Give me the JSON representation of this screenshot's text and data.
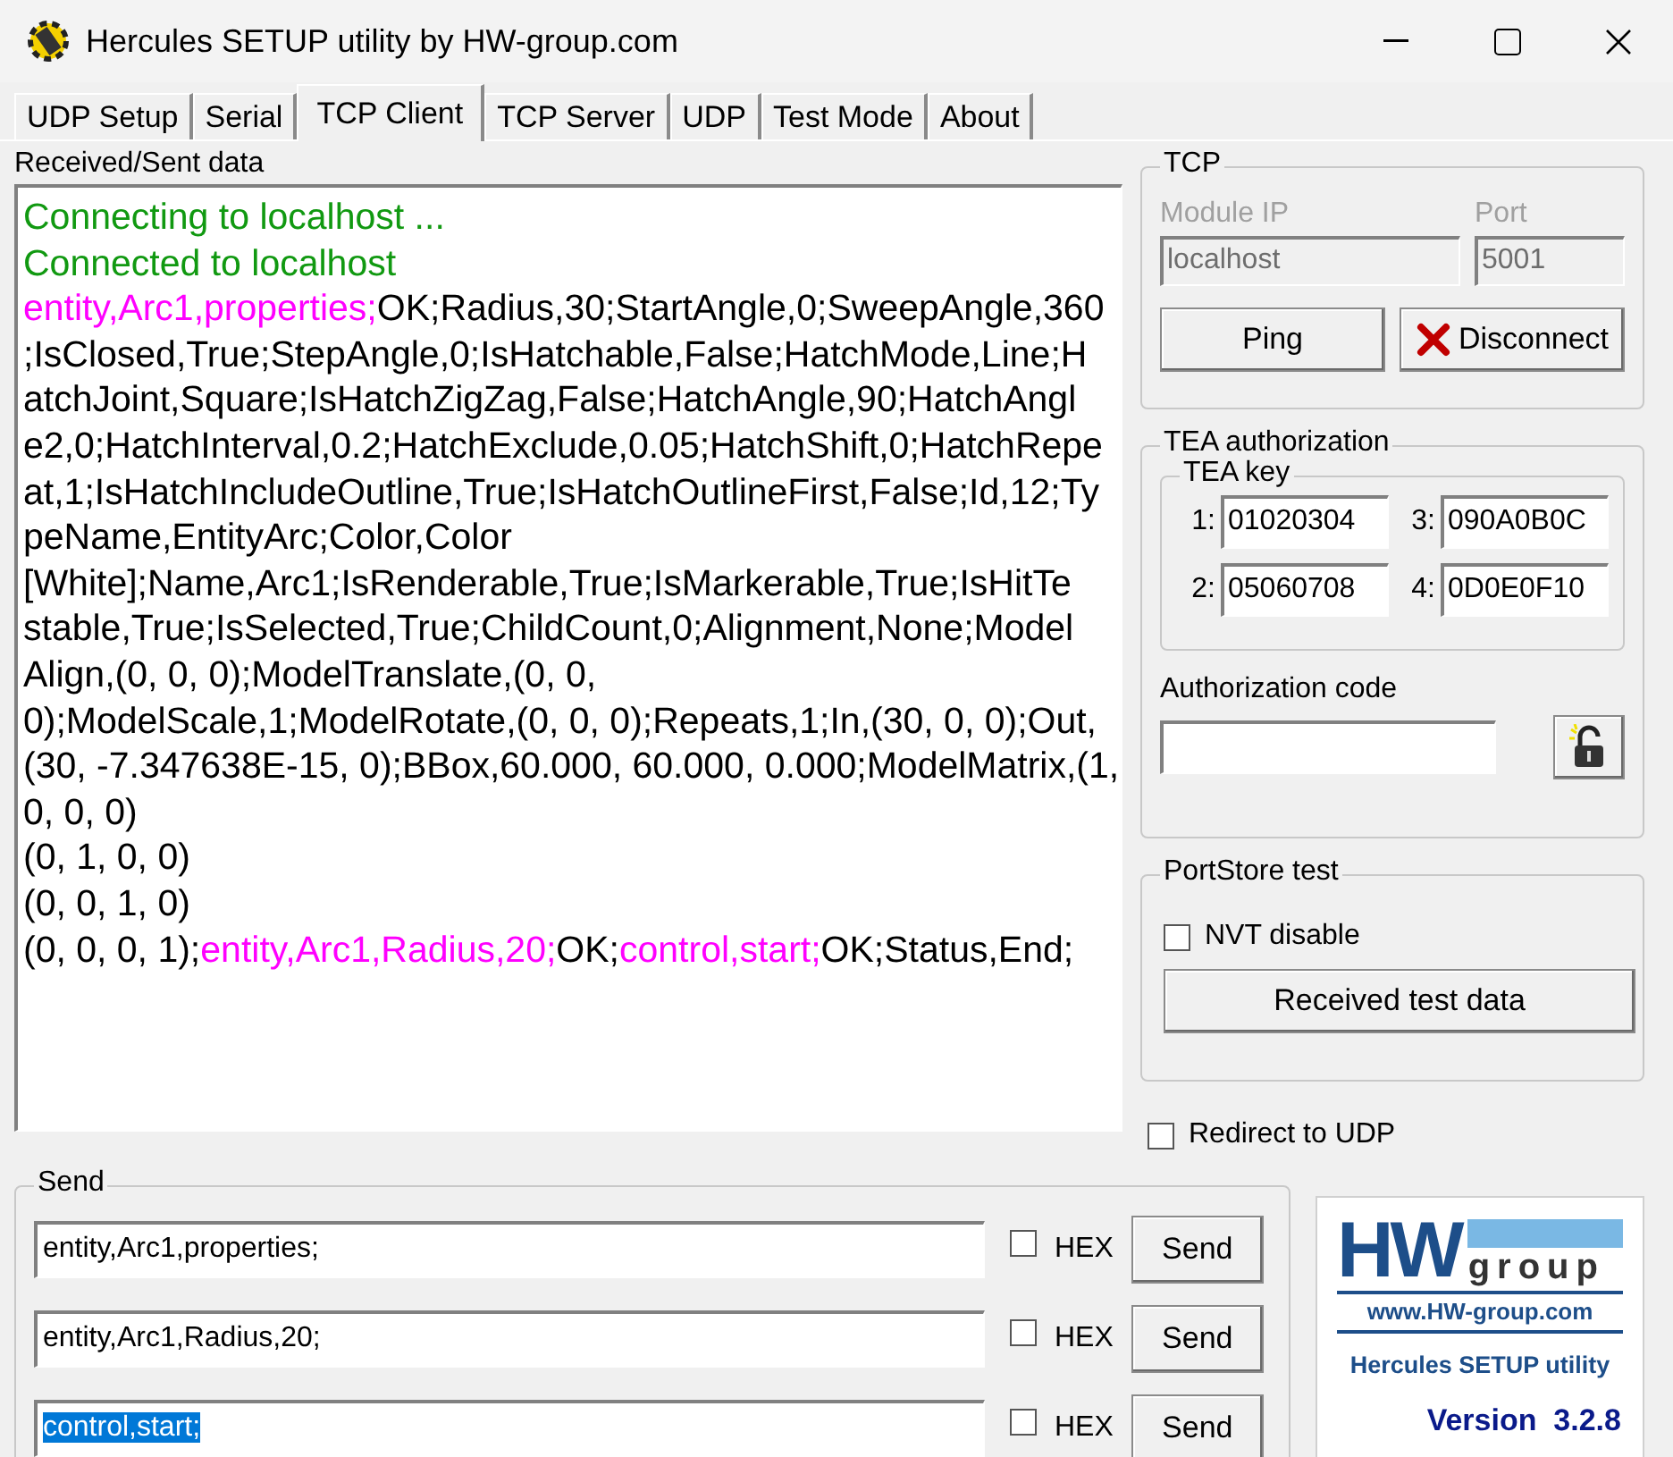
{
  "window": {
    "title": "Hercules SETUP utility by HW-group.com"
  },
  "tabs": [
    {
      "label": "UDP Setup",
      "selected": false
    },
    {
      "label": "Serial",
      "selected": false
    },
    {
      "label": "TCP Client",
      "selected": true
    },
    {
      "label": "TCP Server",
      "selected": false
    },
    {
      "label": "UDP",
      "selected": false
    },
    {
      "label": "Test Mode",
      "selected": false
    },
    {
      "label": "About",
      "selected": false
    }
  ],
  "log": {
    "title": "Received/Sent data",
    "lines": [
      [
        {
          "kind": "status",
          "text": "Connecting to localhost ..."
        }
      ],
      [
        {
          "kind": "status",
          "text": "Connected to localhost"
        }
      ],
      [
        {
          "kind": "sent",
          "text": "entity,Arc1,properties;"
        },
        {
          "kind": "received",
          "text": "OK;Radius,30;StartAngle,0;SweepAngle,360"
        }
      ],
      [
        {
          "kind": "received",
          "text": ";IsClosed,True;StepAngle,0;IsHatchable,False;HatchMode,Line;H"
        }
      ],
      [
        {
          "kind": "received",
          "text": "atchJoint,Square;IsHatchZigZag,False;HatchAngle,90;HatchAngl"
        }
      ],
      [
        {
          "kind": "received",
          "text": "e2,0;HatchInterval,0.2;HatchExclude,0.05;HatchShift,0;HatchRepe"
        }
      ],
      [
        {
          "kind": "received",
          "text": "at,1;IsHatchIncludeOutline,True;IsHatchOutlineFirst,False;Id,12;Ty"
        }
      ],
      [
        {
          "kind": "received",
          "text": "peName,EntityArc;Color,Color"
        }
      ],
      [
        {
          "kind": "received",
          "text": "[White];Name,Arc1;IsRenderable,True;IsMarkerable,True;IsHitTe"
        }
      ],
      [
        {
          "kind": "received",
          "text": "stable,True;IsSelected,True;ChildCount,0;Alignment,None;Model"
        }
      ],
      [
        {
          "kind": "received",
          "text": "Align,(0, 0, 0);ModelTranslate,(0, 0,"
        }
      ],
      [
        {
          "kind": "received",
          "text": "0);ModelScale,1;ModelRotate,(0, 0, 0);Repeats,1;In,(30, 0, 0);Out,"
        }
      ],
      [
        {
          "kind": "received",
          "text": "(30, -7.347638E-15, 0);BBox,60.000, 60.000, 0.000;ModelMatrix,(1,"
        }
      ],
      [
        {
          "kind": "received",
          "text": "0, 0, 0)"
        }
      ],
      [
        {
          "kind": "received",
          "text": "(0, 1, 0, 0)"
        }
      ],
      [
        {
          "kind": "received",
          "text": "(0, 0, 1, 0)"
        }
      ],
      [
        {
          "kind": "received",
          "text": "(0, 0, 0, 1);"
        },
        {
          "kind": "sent",
          "text": "entity,Arc1,Radius,20;"
        },
        {
          "kind": "received",
          "text": "OK;"
        },
        {
          "kind": "sent",
          "text": "control,start;"
        },
        {
          "kind": "received",
          "text": "OK;Status,End;"
        }
      ]
    ]
  },
  "tcp": {
    "title": "TCP",
    "module_ip": {
      "label": "Module IP",
      "value": "localhost",
      "disabled": true
    },
    "port": {
      "label": "Port",
      "value": "5001",
      "disabled": true
    },
    "ping": "Ping",
    "disconnect": "Disconnect"
  },
  "tea": {
    "title": "TEA authorization",
    "key_title": "TEA key",
    "keys": [
      {
        "label": "1:",
        "value": "01020304"
      },
      {
        "label": "3:",
        "value": "090A0B0C"
      },
      {
        "label": "2:",
        "value": "05060708"
      },
      {
        "label": "4:",
        "value": "0D0E0F10"
      }
    ],
    "auth_label": "Authorization code"
  },
  "portstore": {
    "title": "PortStore test",
    "nvt": {
      "label": "NVT disable",
      "checked": false
    },
    "button": "Received test data"
  },
  "redirect": {
    "label": "Redirect to UDP",
    "checked": false
  },
  "send": {
    "title": "Send",
    "rows": [
      {
        "value": "entity,Arc1,properties;",
        "text_selected": false,
        "hex_label": "HEX",
        "hex": false,
        "button": "Send"
      },
      {
        "value": "entity,Arc1,Radius,20;",
        "text_selected": false,
        "hex_label": "HEX",
        "hex": false,
        "button": "Send"
      },
      {
        "value": "control,start;",
        "text_selected": true,
        "hex_label": "HEX",
        "hex": false,
        "button": "Send"
      }
    ]
  },
  "logo": {
    "brand": "HW",
    "sub": "group",
    "url": "www.HW-group.com",
    "product": "Hercules SETUP utility",
    "version": "Version  3.2.8"
  }
}
